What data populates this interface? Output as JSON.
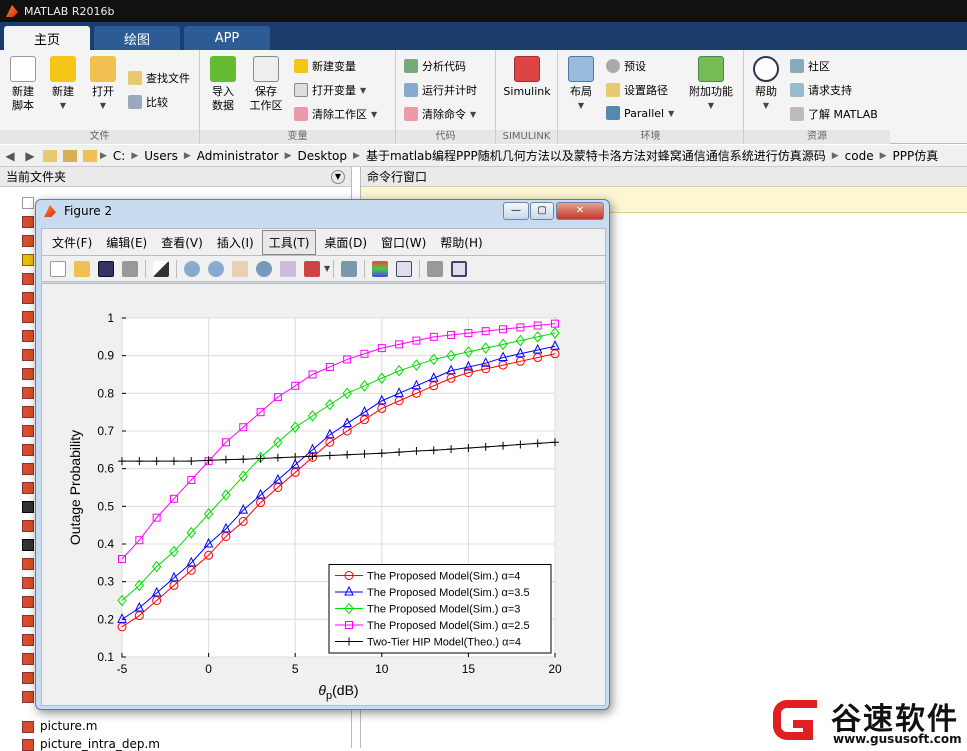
{
  "app": {
    "title": "MATLAB R2016b"
  },
  "tabs": [
    {
      "label": "主页",
      "active": true
    },
    {
      "label": "绘图",
      "active": false
    },
    {
      "label": "APP",
      "active": false
    }
  ],
  "ribbon": {
    "file": {
      "title": "文件",
      "new_script": [
        "新建",
        "脚本"
      ],
      "new": "新建",
      "open": "打开",
      "find_files": "查找文件",
      "compare": "比较"
    },
    "variable": {
      "title": "变量",
      "import": [
        "导入",
        "数据"
      ],
      "save": [
        "保存",
        "工作区"
      ],
      "new_var": "新建变量",
      "open_var": "打开变量",
      "clear_ws": "清除工作区"
    },
    "code": {
      "title": "代码",
      "analyze": "分析代码",
      "run_time": "运行并计时",
      "clear_cmd": "清除命令"
    },
    "simulink": {
      "title": "SIMULINK",
      "btn": "Simulink"
    },
    "env": {
      "title": "环境",
      "layout": "布局",
      "prefs": "预设",
      "set_path": "设置路径",
      "parallel": "Parallel",
      "addons": "附加功能"
    },
    "resources": {
      "title": "资源",
      "help": "帮助",
      "community": "社区",
      "request_support": "请求支持",
      "learn": "了解 MATLAB"
    }
  },
  "address": {
    "segments": [
      "C:",
      "Users",
      "Administrator",
      "Desktop",
      "基于matlab编程PPP随机几何方法以及蒙特卡洛方法对蜂窝通信通信系统进行仿真源码",
      "code",
      "PPP仿真"
    ]
  },
  "left_panel": {
    "title": "当前文件夹",
    "files_visible": [
      "picture.m",
      "picture_intra_dep.m"
    ]
  },
  "right_panel": {
    "title": "命令行窗口"
  },
  "figure": {
    "title": "Figure 2",
    "menu": [
      "文件(F)",
      "编辑(E)",
      "查看(V)",
      "插入(I)",
      "工具(T)",
      "桌面(D)",
      "窗口(W)",
      "帮助(H)"
    ],
    "active_menu": "工具(T)"
  },
  "chart_data": {
    "type": "line",
    "xlabel": "θp(dB)",
    "ylabel": "Outage Probability",
    "xlim": [
      -5,
      20
    ],
    "ylim": [
      0.1,
      1
    ],
    "xticks": [
      "-5",
      "0",
      "5",
      "10",
      "15",
      "20"
    ],
    "yticks": [
      "0.1",
      "0.2",
      "0.3",
      "0.4",
      "0.5",
      "0.6",
      "0.7",
      "0.8",
      "0.9",
      "1"
    ],
    "grid": true,
    "legend_position": "bottom-right",
    "x": [
      -5,
      -4,
      -3,
      -2,
      -1,
      0,
      1,
      2,
      3,
      4,
      5,
      6,
      7,
      8,
      9,
      10,
      11,
      12,
      13,
      14,
      15,
      16,
      17,
      18,
      19,
      20
    ],
    "series": [
      {
        "name": "The Proposed Model(Sim.) α=4",
        "color": "#ff0000",
        "marker": "circle",
        "values": [
          0.18,
          0.21,
          0.25,
          0.29,
          0.33,
          0.37,
          0.42,
          0.46,
          0.51,
          0.55,
          0.59,
          0.63,
          0.67,
          0.7,
          0.73,
          0.76,
          0.78,
          0.8,
          0.82,
          0.84,
          0.855,
          0.865,
          0.875,
          0.885,
          0.895,
          0.905
        ]
      },
      {
        "name": "The Proposed Model(Sim.) α=3.5",
        "color": "#0000ff",
        "marker": "triangle",
        "values": [
          0.2,
          0.23,
          0.27,
          0.31,
          0.35,
          0.4,
          0.44,
          0.49,
          0.53,
          0.57,
          0.61,
          0.65,
          0.69,
          0.72,
          0.75,
          0.78,
          0.8,
          0.82,
          0.84,
          0.86,
          0.87,
          0.88,
          0.895,
          0.905,
          0.915,
          0.925
        ]
      },
      {
        "name": "The Proposed Model(Sim.) α=3",
        "color": "#00dd00",
        "marker": "diamond",
        "values": [
          0.25,
          0.29,
          0.34,
          0.38,
          0.43,
          0.48,
          0.53,
          0.58,
          0.63,
          0.67,
          0.71,
          0.74,
          0.77,
          0.8,
          0.82,
          0.84,
          0.86,
          0.875,
          0.89,
          0.9,
          0.91,
          0.92,
          0.93,
          0.94,
          0.95,
          0.96
        ]
      },
      {
        "name": "The Proposed Model(Sim.) α=2.5",
        "color": "#ff00ff",
        "marker": "square",
        "values": [
          0.36,
          0.41,
          0.47,
          0.52,
          0.57,
          0.62,
          0.67,
          0.71,
          0.75,
          0.79,
          0.82,
          0.85,
          0.87,
          0.89,
          0.905,
          0.92,
          0.93,
          0.94,
          0.95,
          0.955,
          0.96,
          0.965,
          0.97,
          0.975,
          0.98,
          0.985
        ]
      },
      {
        "name": "Two-Tier HIP Model(Theo.) α=4",
        "color": "#000000",
        "marker": "plus",
        "values": [
          0.62,
          0.62,
          0.62,
          0.62,
          0.62,
          0.622,
          0.624,
          0.625,
          0.627,
          0.629,
          0.631,
          0.633,
          0.635,
          0.637,
          0.639,
          0.641,
          0.644,
          0.647,
          0.649,
          0.652,
          0.655,
          0.658,
          0.661,
          0.664,
          0.667,
          0.67
        ]
      }
    ]
  },
  "watermark": {
    "name": "谷速软件",
    "url": "www.gususoft.com"
  }
}
